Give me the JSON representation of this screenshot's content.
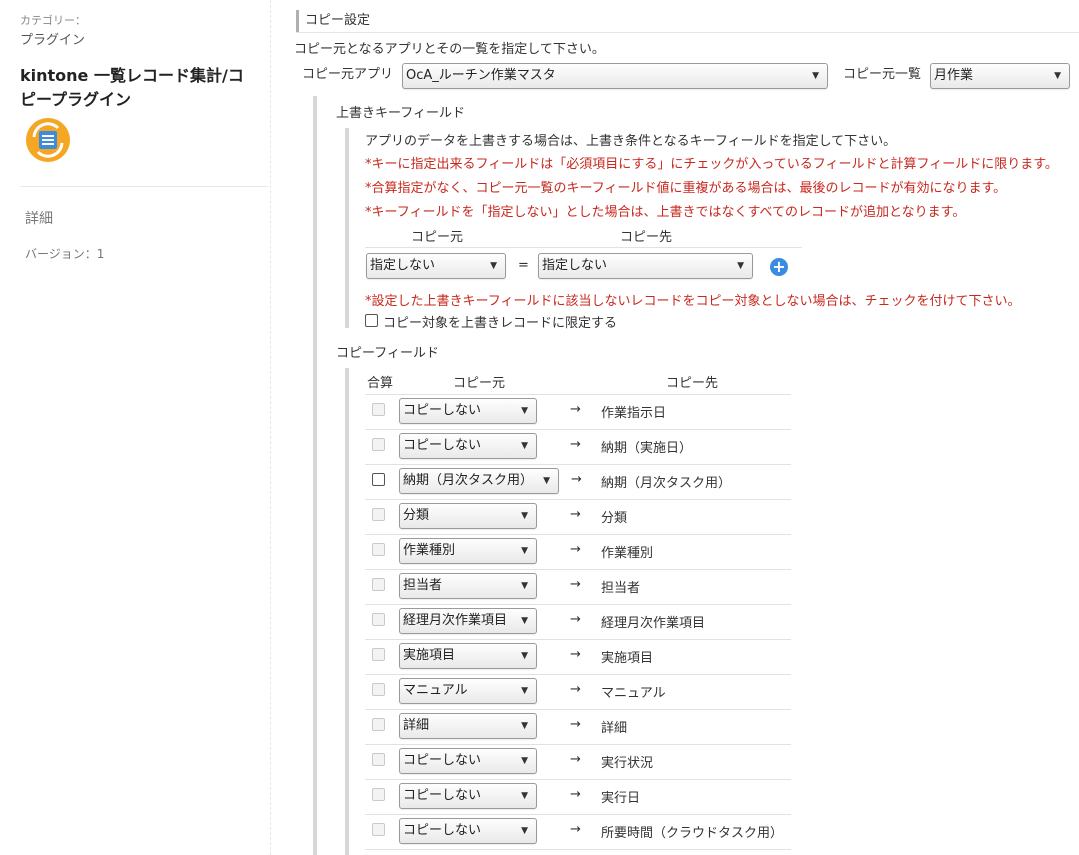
{
  "sidebar": {
    "category_label": "カテゴリー：",
    "category_value": "プラグイン",
    "plugin_title_line1": "kintone 一覧レコード集計/コ",
    "plugin_title_line2": "ピープラグイン",
    "icon": "plugin-app-icon",
    "detail_link": "詳細",
    "version": "バージョン：1"
  },
  "copy_settings": {
    "title": "コピー設定",
    "instruction": "コピー元となるアプリとその一覧を指定して下さい。",
    "source_app_label": "コピー元アプリ",
    "source_app_value": "OcA_ルーチン作業マスタ",
    "source_view_label": "コピー元一覧",
    "source_view_value": "月作業"
  },
  "overwrite": {
    "title": "上書きキーフィールド",
    "note1": "アプリのデータを上書きする場合は、上書き条件となるキーフィールドを指定して下さい。",
    "note2": "*キーに指定出来るフィールドは「必須項目にする」にチェックが入っているフィールドと計算フィールドに限ります。",
    "note3": "*合算指定がなく、コピー元一覧のキーフィールド値に重複がある場合は、最後のレコードが有効になります。",
    "note4": "*キーフィールドを「指定しない」とした場合は、上書きではなくすべてのレコードが追加となります。",
    "col_source": "コピー元",
    "col_dest": "コピー先",
    "source_value": "指定しない",
    "equals": "=",
    "dest_value": "指定しない",
    "note5": "*設定した上書きキーフィールドに該当しないレコードをコピー対象としない場合は、チェックを付けて下さい。",
    "limit_label": "コピー対象を上書きレコードに限定する"
  },
  "copy_fields": {
    "title": "コピーフィールド",
    "col_sum": "合算",
    "col_source": "コピー元",
    "col_dest": "コピー先",
    "arrow": "→",
    "rows": [
      {
        "source": "コピーしない",
        "dest": "作業指示日"
      },
      {
        "source": "コピーしない",
        "dest": "納期（実施日）"
      },
      {
        "source": "納期（月次タスク用）",
        "dest": "納期（月次タスク用）"
      },
      {
        "source": "分類",
        "dest": "分類"
      },
      {
        "source": "作業種別",
        "dest": "作業種別"
      },
      {
        "source": "担当者",
        "dest": "担当者"
      },
      {
        "source": "経理月次作業項目",
        "dest": "経理月次作業項目"
      },
      {
        "source": "実施項目",
        "dest": "実施項目"
      },
      {
        "source": "マニュアル",
        "dest": "マニュアル"
      },
      {
        "source": "詳細",
        "dest": "詳細"
      },
      {
        "source": "コピーしない",
        "dest": "実行状況"
      },
      {
        "source": "コピーしない",
        "dest": "実行日"
      },
      {
        "source": "コピーしない",
        "dest": "所要時間（クラウドタスク用）"
      }
    ]
  },
  "colors": {
    "accent": "#3b8be0",
    "note_red": "#c8281e"
  }
}
